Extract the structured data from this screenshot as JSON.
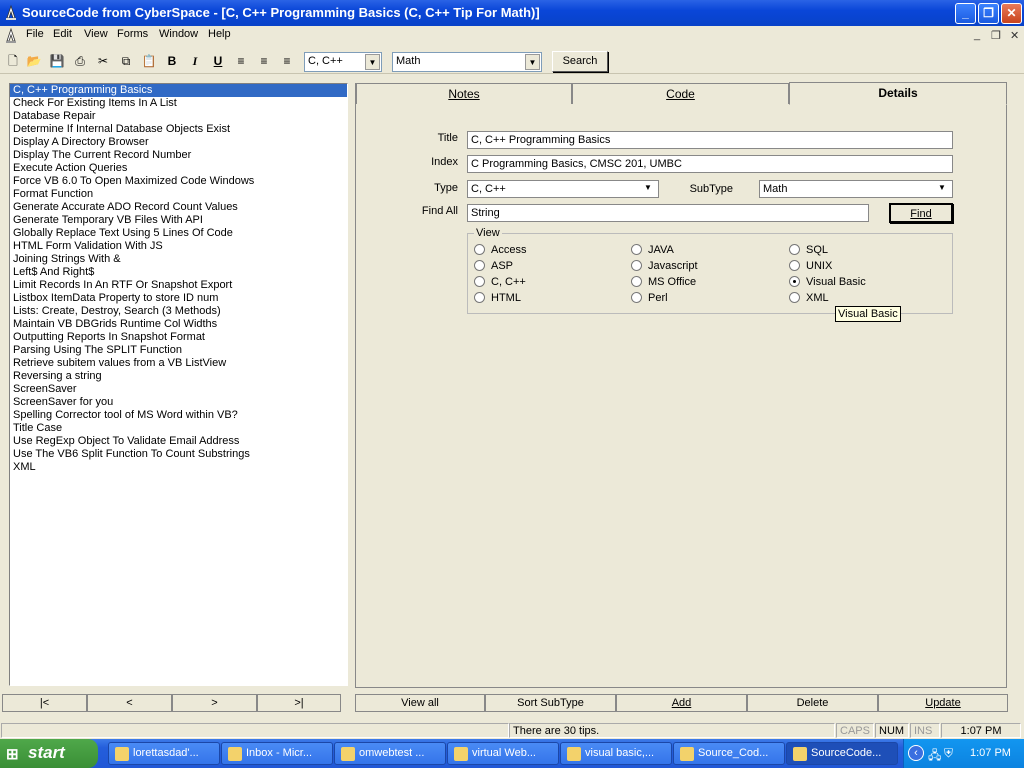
{
  "window": {
    "title": "SourceCode from CyberSpace - [C, C++ Programming Basics (C, C++ Tip For Math)]"
  },
  "menu": [
    "File",
    "Edit",
    "View",
    "Forms",
    "Window",
    "Help"
  ],
  "toolbar": {
    "language_select": "C, C++",
    "subtype_select": "Math",
    "search_label": "Search",
    "icons": [
      "new-icon",
      "open-icon",
      "save-icon",
      "print-icon",
      "cut-icon",
      "copy-icon",
      "paste-icon",
      "bold-icon",
      "italic-icon",
      "underline-icon",
      "align-left-icon",
      "align-center-icon",
      "align-right-icon"
    ]
  },
  "list": {
    "selected_index": 0,
    "items": [
      "C, C++ Programming Basics",
      "Check For Existing Items In A List",
      "Database Repair",
      "Determine If Internal Database Objects Exist",
      "Display A Directory Browser",
      "Display The Current Record Number",
      "Execute Action Queries",
      "Force VB 6.0 To Open Maximized Code Windows",
      "Format Function",
      "Generate Accurate ADO Record Count Values",
      "Generate Temporary VB Files With API",
      "Globally Replace Text Using 5 Lines Of Code",
      "HTML Form Validation With JS",
      "Joining Strings With &",
      "Left$ And Right$",
      "Limit Records In An RTF Or Snapshot Export",
      "Listbox ItemData Property to store ID num",
      "Lists: Create, Destroy, Search (3 Methods)",
      "Maintain VB DBGrids Runtime Col Widths",
      "Outputting Reports In Snapshot Format",
      "Parsing Using The SPLIT Function",
      "Retrieve subitem values from a VB ListView",
      "Reversing a string",
      "ScreenSaver",
      "ScreenSaver for you",
      "Spelling Corrector tool of MS Word within VB?",
      "Title Case",
      "Use RegExp Object To Validate Email Address",
      "Use The VB6 Split Function To Count Substrings",
      "XML"
    ]
  },
  "tabs": {
    "notes": "Notes",
    "code": "Code",
    "details": "Details"
  },
  "details": {
    "title_label": "Title",
    "title_value": "C, C++ Programming Basics",
    "index_label": "Index",
    "index_value": "C Programming Basics, CMSC 201, UMBC",
    "type_label": "Type",
    "type_value": "C, C++",
    "subtype_label": "SubType",
    "subtype_value": "Math",
    "findall_label": "Find All",
    "findall_value": "String",
    "find_button": "Find",
    "view_label": "View",
    "view_options": [
      "Access",
      "ASP",
      "C, C++",
      "HTML",
      "JAVA",
      "Javascript",
      "MS Office",
      "Perl",
      "SQL",
      "UNIX",
      "Visual Basic",
      "XML"
    ],
    "view_selected": "Visual Basic",
    "tooltip": "Visual Basic"
  },
  "nav_buttons": [
    "|<",
    "<",
    ">",
    ">|"
  ],
  "actions": {
    "view_all": "View all",
    "sort_subtype": "Sort SubType",
    "add": "Add",
    "delete": "Delete",
    "update": "Update"
  },
  "status": {
    "message": "There are 30 tips.",
    "caps": "CAPS",
    "num": "NUM",
    "ins": "INS",
    "time": "1:07 PM"
  },
  "taskbar": {
    "start": "start",
    "tasks": [
      "lorettasdad'...",
      "Inbox - Micr...",
      "omwebtest ...",
      "virtual Web...",
      "visual basic,...",
      "Source_Cod...",
      "SourceCode..."
    ],
    "active_task": 6,
    "clock": "1:07 PM"
  },
  "colors": {
    "title_blue": "#0a46d8",
    "selection": "#316ac5",
    "tooltip_bg": "#ffffe1",
    "taskbar": "#245edb",
    "start_green": "#3a8f36"
  }
}
